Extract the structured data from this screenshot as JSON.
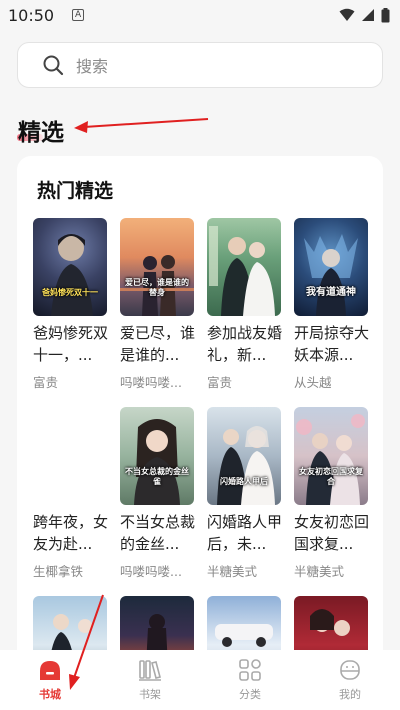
{
  "status": {
    "time": "10:50",
    "a_badge": "A"
  },
  "search": {
    "placeholder": "搜索"
  },
  "section": {
    "heading": "精选"
  },
  "card": {
    "title": "热门精选"
  },
  "books": [
    {
      "title": "爸妈惨死双十一，...",
      "author": "富贵",
      "cover_text": "爸妈惨死双十一"
    },
    {
      "title": "爱已尽，谁是谁的...",
      "author": "吗喽吗喽...",
      "cover_text": "爱已尽，谁是谁的替身"
    },
    {
      "title": "参加战友婚礼，新...",
      "author": "富贵",
      "cover_text": ""
    },
    {
      "title": "开局掠夺大妖本源...",
      "author": "从头越",
      "cover_text": "我有道通神"
    },
    {
      "title": "跨年夜，女友为赴...",
      "author": "生椰拿铁",
      "cover_text": ""
    },
    {
      "title": "不当女总裁的金丝...",
      "author": "吗喽吗喽...",
      "cover_text": "不当女总裁的金丝雀"
    },
    {
      "title": "闪婚路人甲后，未...",
      "author": "半糖美式",
      "cover_text": "闪婚路人甲后"
    },
    {
      "title": "女友初恋回国求复...",
      "author": "半糖美式",
      "cover_text": "女友初恋回国求复合"
    }
  ],
  "tabs": [
    {
      "label": "书城",
      "active": true
    },
    {
      "label": "书架",
      "active": false
    },
    {
      "label": "分类",
      "active": false
    },
    {
      "label": "我的",
      "active": false
    }
  ]
}
